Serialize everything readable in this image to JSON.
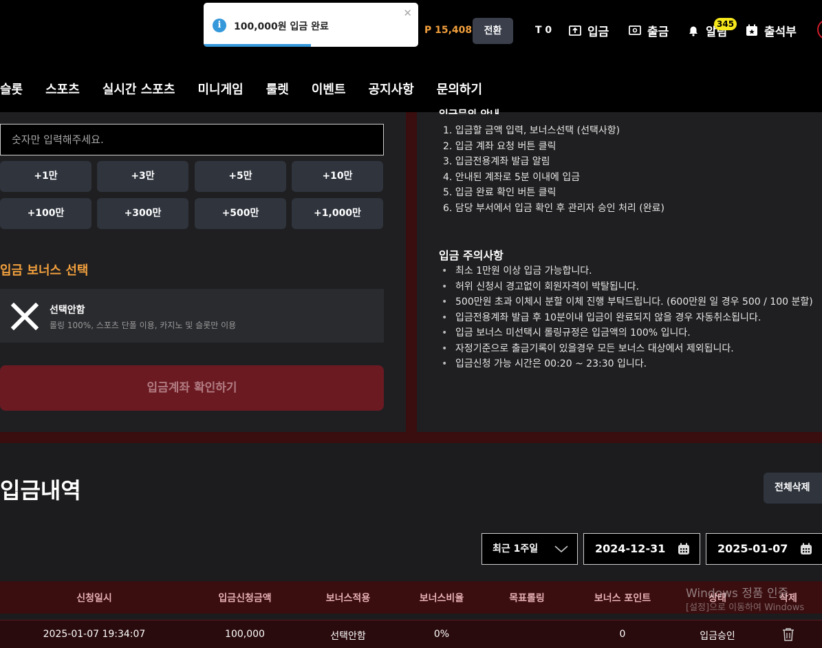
{
  "toast": {
    "message": "100,000원 입금 완료",
    "progress": 0.5
  },
  "header": {
    "points": "P 15,408",
    "convert_label": "전환",
    "t_count": "T 0",
    "deposit_label": "입금",
    "withdraw_label": "출금",
    "notification_label": "알림",
    "notification_count": "345",
    "attendance_label": "출석부"
  },
  "nav": [
    "슬롯",
    "스포츠",
    "실시간 스포츠",
    "미니게임",
    "룰렛",
    "이벤트",
    "공지사항",
    "문의하기"
  ],
  "deposit_form": {
    "amount_placeholder": "숫자만 입력해주세요.",
    "amount_buttons": [
      "+1만",
      "+3만",
      "+5만",
      "+10만",
      "+100만",
      "+300만",
      "+500만",
      "+1,000만"
    ],
    "bonus_title": "입금 보너스 선택",
    "bonus_option": {
      "name": "선택안함",
      "description": "롤링 100%, 스포츠 단폴 이용, 카지노 및 슬롯만 이용"
    },
    "confirm_label": "입금계좌 확인하기"
  },
  "guide": {
    "title": "입금문의 안내",
    "steps": [
      "1. 입금할 금액 입력, 보너스선택 (선택사항)",
      "2. 입금 계좌 요청 버튼 클릭",
      "3. 입금전용계좌 발급 알림",
      "4. 안내된 계좌로 5분 이내에 입금",
      "5. 입금 완료 확인 버튼 클릭",
      "6. 담당 부서에서 입금 확인 후 관리자 승인 처리 (완료)"
    ],
    "caution_title": "입금 주의사항",
    "cautions": [
      "최소 1만원 이상 입금 가능합니다.",
      "허위 신청시 경고없이 회원자격이 박탈됩니다.",
      "500만원 초과 이체시 분할 이체 진행 부탁드립니다. (600만원 일 경우 500 / 100 분할)",
      "입금전용계좌 발급 후 10분이내 입금이 완료되지 않을 경우 자동취소됩니다.",
      "입금 보너스 미선택시 롤링규정은 입금액의 100% 입니다.",
      "자정기준으로 출금기록이 있을경우 모든 보너스 대상에서 제외됩니다.",
      "입금신청 가능 시간은 00:20 ~ 23:30 입니다."
    ]
  },
  "history": {
    "title": "입금내역",
    "delete_all_label": "전체삭제",
    "period": "최근 1주일",
    "date_from": "2024-12-31",
    "date_to": "2025-01-07",
    "columns": [
      "신청일시",
      "입금신청금액",
      "보너스적용",
      "보너스비율",
      "목표롤링",
      "보너스 포인트",
      "상태",
      "삭제"
    ],
    "rows": [
      {
        "date": "2025-01-07 19:34:07",
        "amount": "100,000",
        "bonus": "선택안함",
        "ratio": "0%",
        "target_rolling": "",
        "bonus_points": "0",
        "status": "입금승인"
      }
    ]
  },
  "watermark": {
    "line1": "Windows 정품 인증",
    "line2": "[설정]으로 이동하여 Windows"
  },
  "colors": {
    "accent": "#f2a03d",
    "brand_red": "#3a0d0f",
    "info_blue": "#3498db",
    "badge_yellow": "#f5e81b"
  }
}
